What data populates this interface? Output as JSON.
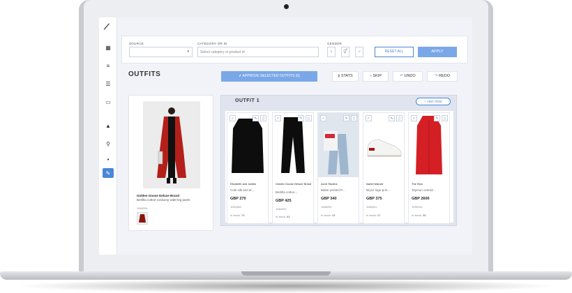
{
  "filters": {
    "source_label": "SOURCE",
    "category_label": "CATEGORY OR ID",
    "category_placeholder": "Select category or product id",
    "gender_label": "GENDER",
    "reset_label": "RESET ALL",
    "apply_label": "APPLY"
  },
  "page": {
    "title": "OUTFITS",
    "approve_label": "APPROVE SELECTED OUTFITS (0)",
    "stats_label": "STATS",
    "skip_label": "SKIP",
    "undo_label": "UNDO",
    "redo_label": "REDO"
  },
  "source_product": {
    "brand": "Golden Goose Deluxe Brand",
    "name": "Bertilla cotton-corduroy wide-leg pants",
    "id": "1084334"
  },
  "outfit": {
    "title": "OUTFIT 1",
    "add_item_label": "+ ADD ITEM",
    "items": [
      {
        "brand": "Elizabeth and James",
        "name": "Cole silk and al...",
        "price": "GBP 270",
        "id": "1054268",
        "stock_label": "In stock:",
        "stock": "75"
      },
      {
        "brand": "Golden Goose Deluxe Brand",
        "name": "Bertilla cotton-...",
        "price": "GBP 425",
        "id": "1084334",
        "stock_label": "In stock:",
        "stock": "63"
      },
      {
        "brand": "Acne Studios",
        "name": "Baker printed P...",
        "price": "GBP 340",
        "id": "1068292",
        "stock_label": "In stock:",
        "stock": "43"
      },
      {
        "brand": "Isabel Marant",
        "name": "Bryce logo-prin...",
        "price": "GBP 375",
        "id": "1082811",
        "stock_label": "In stock:",
        "stock": "47"
      },
      {
        "brand": "The Row",
        "name": "Taymon oversiz...",
        "price": "GBP 2600",
        "id": "1059144",
        "stock_label": "In stock:",
        "stock": "38"
      }
    ]
  },
  "colors": {
    "accent": "#4a86d8",
    "primary_button": "#7aa7e8",
    "panel_bg": "#dfe4ee"
  }
}
